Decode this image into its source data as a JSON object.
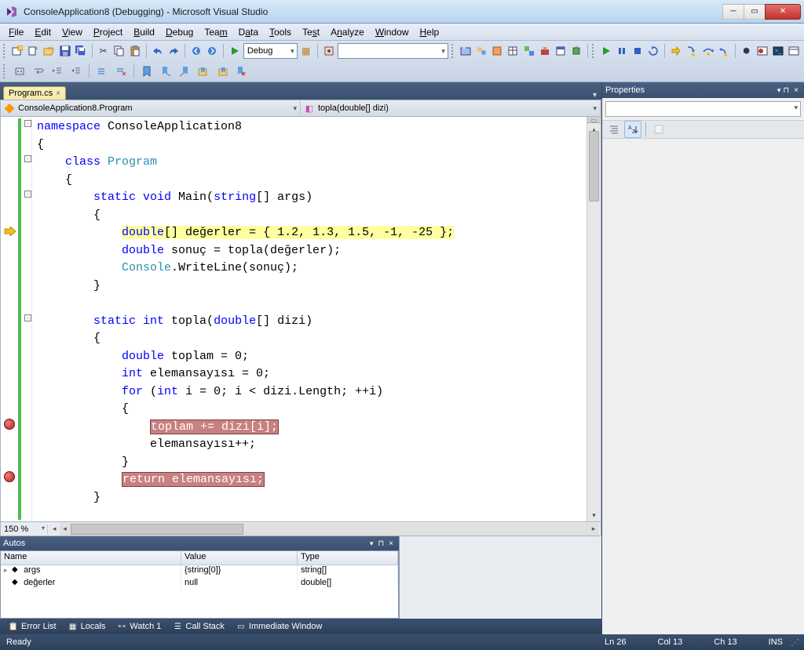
{
  "window": {
    "title": "ConsoleApplication8 (Debugging) - Microsoft Visual Studio"
  },
  "menu": [
    "File",
    "Edit",
    "View",
    "Project",
    "Build",
    "Debug",
    "Team",
    "Data",
    "Tools",
    "Test",
    "Analyze",
    "Window",
    "Help"
  ],
  "toolbar": {
    "config": "Debug",
    "platform_icon": "▦",
    "search": ""
  },
  "tabs": {
    "active": "Program.cs"
  },
  "nav": {
    "scope": "ConsoleApplication8.Program",
    "member": "topla(double[] dizi)"
  },
  "code": {
    "l1_a": "namespace",
    "l1_b": " ConsoleApplication8",
    "l2": "{",
    "l3_a": "    class",
    "l3_b": " Program",
    "l4": "    {",
    "l5_a": "        static",
    "l5_b": " void",
    "l5_c": " Main(",
    "l5_d": "string",
    "l5_e": "[] args)",
    "l6": "        {",
    "l7_pre": "            ",
    "l7_hl_a": "double",
    "l7_hl_b": "[] değerler = { 1.2, 1.3, 1.5, -1, -25 };",
    "l8_a": "            double",
    "l8_b": " sonuç = topla(değerler);",
    "l9_a": "            Console",
    "l9_b": ".WriteLine(sonuç);",
    "l10": "        }",
    "l11": "",
    "l12_a": "        static",
    "l12_b": " int",
    "l12_c": " topla(",
    "l12_d": "double",
    "l12_e": "[] dizi)",
    "l13": "        {",
    "l14_a": "            double",
    "l14_b": " toplam = 0;",
    "l15_a": "            int",
    "l15_b": " elemansayısı = 0;",
    "l16_a": "            for",
    "l16_b": " (",
    "l16_c": "int",
    "l16_d": " i = 0; i < dizi.Length; ++i)",
    "l17": "            {",
    "l18_pre": "                ",
    "l18_hl": "toplam += dizi[i];",
    "l19": "                elemansayısı++;",
    "l20": "            }",
    "l21_pre": "            ",
    "l21_hl": "return elemansayısı;",
    "l22": "        }",
    "l23": "",
    "l24": "    }"
  },
  "zoom": "150 %",
  "autos": {
    "title": "Autos",
    "cols": {
      "name": "Name",
      "value": "Value",
      "type": "Type"
    },
    "rows": [
      {
        "name": "args",
        "value": "{string[0]}",
        "type": "string[]"
      },
      {
        "name": "değerler",
        "value": "null",
        "type": "double[]"
      }
    ]
  },
  "properties": {
    "title": "Properties"
  },
  "tool_strip": [
    "Error List",
    "Locals",
    "Watch 1",
    "Call Stack",
    "Immediate Window"
  ],
  "status": {
    "ready": "Ready",
    "ln": "Ln 26",
    "col": "Col 13",
    "ch": "Ch 13",
    "ins": "INS"
  }
}
